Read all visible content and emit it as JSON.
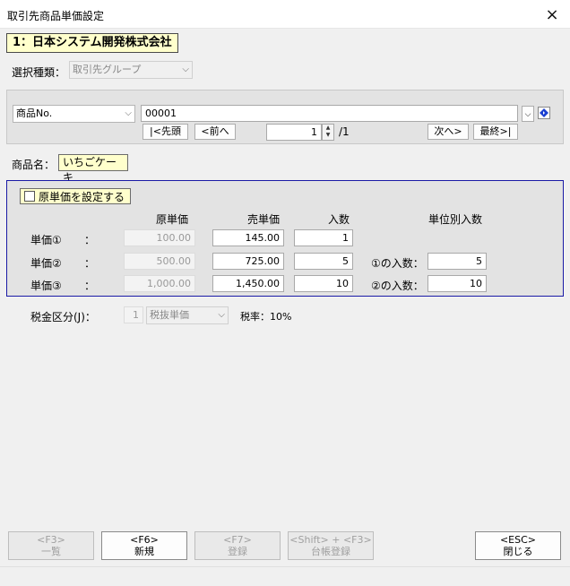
{
  "window": {
    "title": "取引先商品単価設定",
    "close_icon": "×"
  },
  "company": "1：日本システム開発株式会社",
  "selection": {
    "label": "選択種類：",
    "value": "取引先グループ"
  },
  "product": {
    "field_select": "商品No.",
    "code_value": "00001",
    "nav": {
      "first": "|<先頭",
      "prev": "<前へ",
      "next": "次へ>",
      "last": "最終>|"
    },
    "page_value": "1",
    "page_total": "/1"
  },
  "product_name": {
    "label": "商品名：",
    "value": "いちごケーキ"
  },
  "prices": {
    "cost_checkbox_label": "原単価を設定する",
    "headers": {
      "cost": "原単価",
      "sell": "売単価",
      "qty": "入数",
      "unit_qty": "単位別入数"
    },
    "rows": [
      {
        "label": "単価①",
        "colon": "：",
        "cost": "100.00",
        "sell": "145.00",
        "qty": "1"
      },
      {
        "label": "単価②",
        "colon": "：",
        "cost": "500.00",
        "sell": "725.00",
        "qty": "5"
      },
      {
        "label": "単価③",
        "colon": "：",
        "cost": "1,000.00",
        "sell": "1,450.00",
        "qty": "10"
      }
    ],
    "unit_rows": [
      {
        "label": "①の入数：",
        "value": "5"
      },
      {
        "label": "②の入数：",
        "value": "10"
      }
    ]
  },
  "tax": {
    "label": "税金区分(J)：",
    "code": "1",
    "type": "税抜単価",
    "rate": "税率：10%"
  },
  "fkeys": [
    {
      "key": "<F3>",
      "label": "一覧",
      "enabled": false
    },
    {
      "key": "<F6>",
      "label": "新規",
      "enabled": true
    },
    {
      "key": "<F7>",
      "label": "登録",
      "enabled": false
    },
    {
      "key": "<Shift> + <F3>",
      "label": "台帳登録",
      "enabled": false
    },
    {
      "key": "<ESC>",
      "label": "閉じる",
      "enabled": true
    }
  ],
  "colors": {
    "company_bg": "#ffffcc",
    "price_box_border": "#1a1aa6",
    "nav_icon": "#1a3fd1"
  },
  "icons": {
    "dropdown": "chevron-down-icon",
    "product_nav": "diamond-nav-icon"
  }
}
